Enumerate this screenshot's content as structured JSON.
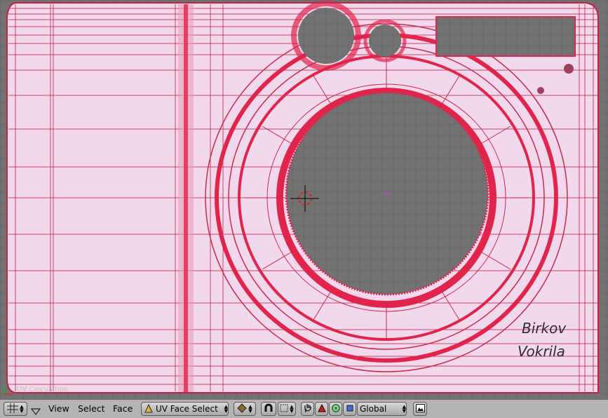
{
  "viewport": {
    "mesh_label": "UV Calculation",
    "signature": {
      "line1": "Birkov",
      "line2": "Vokrila"
    }
  },
  "header": {
    "editor_type_icon": "grid-icon",
    "menus": [
      "View",
      "Select",
      "Face"
    ],
    "mode_select": "UV Face Select",
    "pivot_icon": "pivot-icon",
    "snap_icon": "magnet-icon",
    "snap_type_icon": "snap-grid-icon",
    "manipulator_icons": [
      "hand-icon",
      "translate-icon",
      "rotate-icon",
      "scale-icon"
    ],
    "orientation": "Global",
    "render_icon": "image-icon"
  },
  "colors": {
    "pink_fill": "#f2d8ec",
    "red_edge": "#e0244c",
    "grid_gray": "#727272",
    "header_bg": "#b4b4b4"
  }
}
